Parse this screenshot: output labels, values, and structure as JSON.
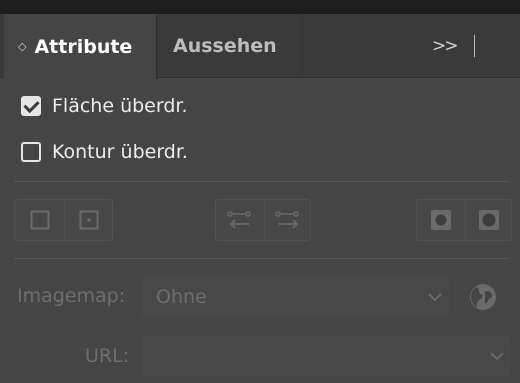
{
  "tabs": [
    {
      "label": "Attribute",
      "active": true
    },
    {
      "label": "Aussehen",
      "active": false
    }
  ],
  "tab_controls": {
    "overflow_icon": "double-chevron-right-icon",
    "menu_icon": "hamburger-menu-icon"
  },
  "options": {
    "fill_override": {
      "label": "Fläche überdr.",
      "checked": true
    },
    "stroke_override": {
      "label": "Kontur überdr.",
      "checked": false
    }
  },
  "button_groups": [
    {
      "name": "shape-display",
      "icons": [
        "square-outline-icon",
        "square-center-point-icon"
      ],
      "enabled": false
    },
    {
      "name": "direction",
      "icons": [
        "arrow-left-icon",
        "arrow-right-icon"
      ],
      "enabled": false
    },
    {
      "name": "fill-rule",
      "icons": [
        "nonzero-fill-icon",
        "even-odd-fill-icon"
      ],
      "enabled": false
    }
  ],
  "imagemap": {
    "label": "Imagemap:",
    "value": "Ohne",
    "enabled": false
  },
  "url": {
    "label": "URL:",
    "value": "",
    "enabled": false
  },
  "colors": {
    "panel_bg": "#454545",
    "tab_bar_bg": "#3a3a3a",
    "text": "#e6e6e6",
    "disabled_text": "#6e6e6e"
  }
}
